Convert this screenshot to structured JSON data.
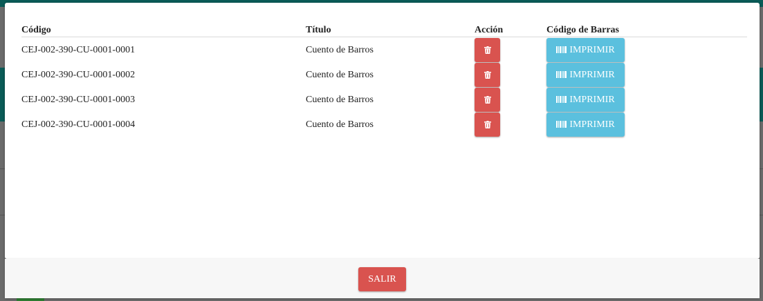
{
  "table": {
    "headers": {
      "code": "Código",
      "title": "Título",
      "action": "Acción",
      "barcode": "Código de Barras"
    },
    "rows": [
      {
        "code": "CEJ-002-390-CU-0001-0001",
        "title": "Cuento de Barros",
        "print_label": "IMPRIMIR"
      },
      {
        "code": "CEJ-002-390-CU-0001-0002",
        "title": "Cuento de Barros",
        "print_label": "IMPRIMIR"
      },
      {
        "code": "CEJ-002-390-CU-0001-0003",
        "title": "Cuento de Barros",
        "print_label": "IMPRIMIR"
      },
      {
        "code": "CEJ-002-390-CU-0001-0004",
        "title": "Cuento de Barros",
        "print_label": "IMPRIMIR"
      }
    ]
  },
  "footer": {
    "exit_label": "SALIR"
  },
  "colors": {
    "danger": "#d9534f",
    "info": "#5bc0de",
    "backdrop_teal": "#0a5b57"
  },
  "icons": {
    "delete": "trash-icon",
    "print": "barcode-icon"
  }
}
